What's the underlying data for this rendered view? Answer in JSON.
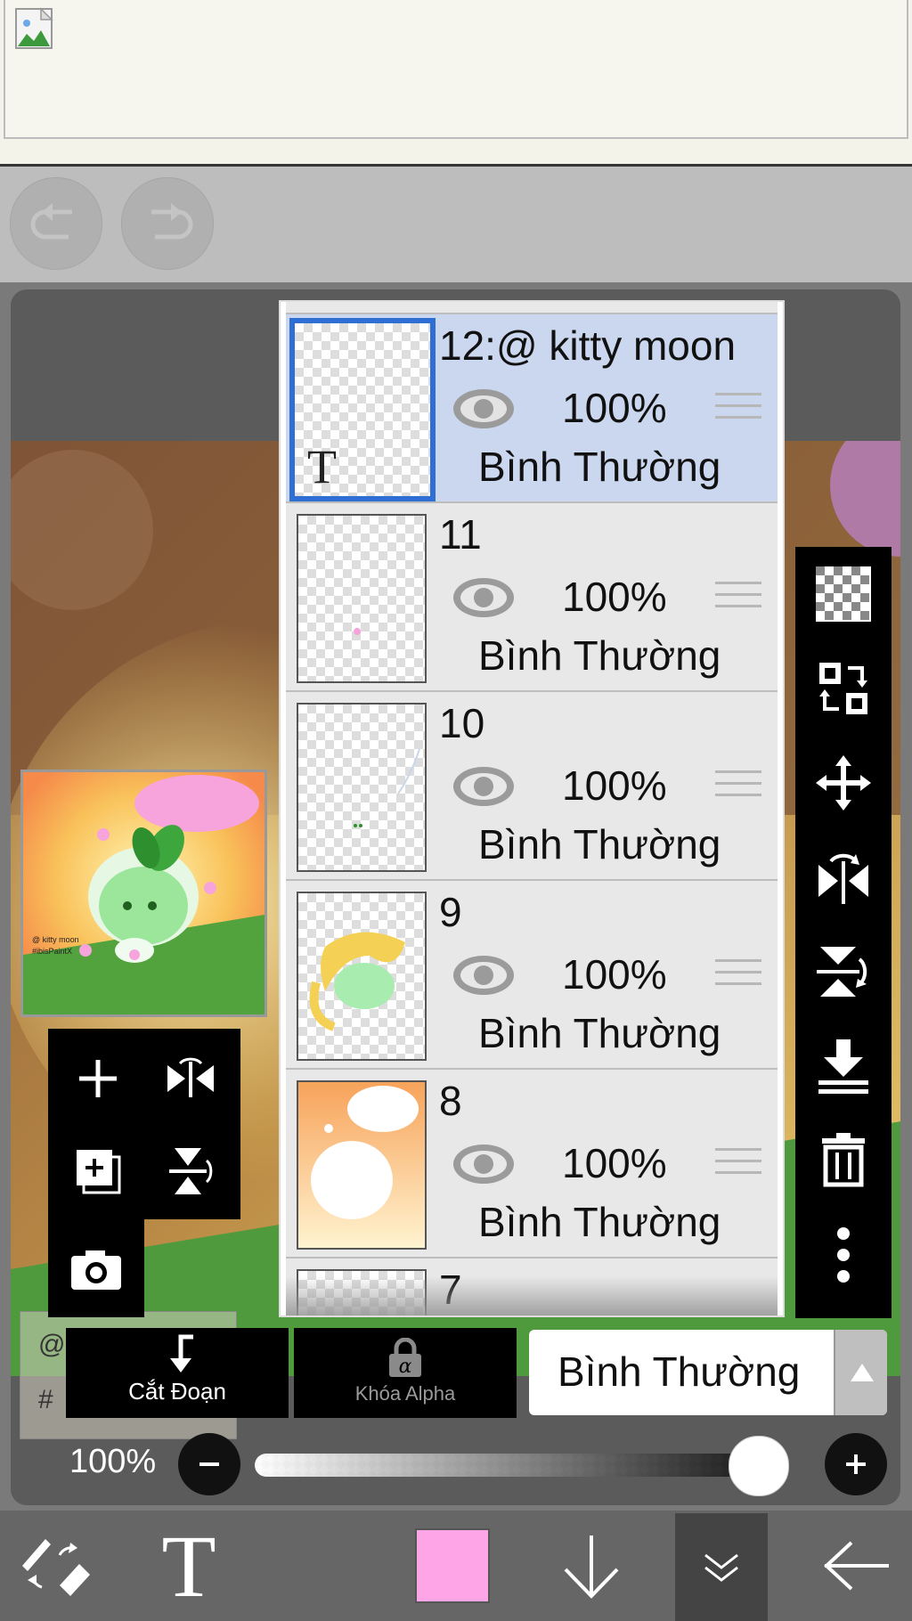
{
  "colors": {
    "selected_layer_bg": "#cad7ee",
    "selected_border": "#2f6fd4",
    "current_color": "#fda5e6",
    "toolbar_black": "#000000"
  },
  "history": {
    "undo_icon": "undo-icon",
    "redo_icon": "redo-icon"
  },
  "thumbnail": {
    "watermark": "@ kitty moon\n#ibisPaintX"
  },
  "text_box": {
    "line1": "@",
    "line2": "#"
  },
  "layers": [
    {
      "name": "12:@ kitty moon",
      "opacity": "100%",
      "blend": "Bình Thường",
      "selected": true
    },
    {
      "name": "11",
      "opacity": "100%",
      "blend": "Bình Thường",
      "selected": false
    },
    {
      "name": "10",
      "opacity": "100%",
      "blend": "Bình Thường",
      "selected": false
    },
    {
      "name": "9",
      "opacity": "100%",
      "blend": "Bình Thường",
      "selected": false
    },
    {
      "name": "8",
      "opacity": "100%",
      "blend": "Bình Thường",
      "selected": false
    },
    {
      "name": "7"
    }
  ],
  "layer_thumb_text": "T",
  "bottom_controls": {
    "clip_label": "Cắt Đoạn",
    "alpha_lock_label": "Khóa Alpha",
    "blend_mode": "Bình Thường",
    "opacity_value": "100%",
    "opacity_fraction": 1.0
  },
  "palette_icons": [
    "plus-icon",
    "flip-horizontal-icon",
    "add-layer-icon",
    "flip-vertical-icon",
    "camera-icon"
  ],
  "right_bar_icons": [
    "transparency-icon",
    "swap-layer-icon",
    "move-icon",
    "flip-horizontal-icon",
    "flip-vertical-icon",
    "merge-down-icon",
    "trash-icon",
    "more-icon"
  ],
  "bottom_bar": {
    "text_tool_glyph": "T"
  }
}
